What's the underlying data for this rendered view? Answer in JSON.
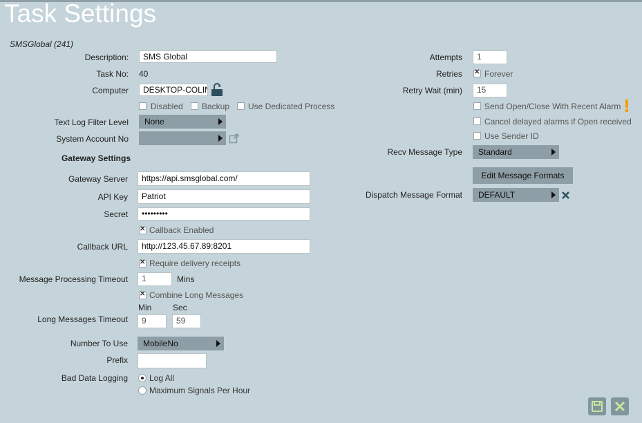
{
  "page": {
    "title": "Task Settings",
    "subtitle": "SMSGlobal (241)"
  },
  "left": {
    "description": {
      "label": "Description:",
      "value": "SMS Global"
    },
    "task_no": {
      "label": "Task No:",
      "value": "40"
    },
    "computer": {
      "label": "Computer",
      "value": "DESKTOP-COLIN"
    },
    "options": {
      "disabled": "Disabled",
      "backup": "Backup",
      "dedicated": "Use Dedicated Process"
    },
    "text_log": {
      "label": "Text Log Filter Level",
      "value": "None"
    },
    "system_account": {
      "label": "System Account No",
      "value": ""
    },
    "gateway_heading": "Gateway Settings",
    "gateway_server": {
      "label": "Gateway Server",
      "value": "https://api.smsglobal.com/"
    },
    "api_key": {
      "label": "API Key",
      "value": "Patriot"
    },
    "secret": {
      "label": "Secret",
      "value": "•••••••••"
    },
    "callback_enabled": "Callback Enabled",
    "callback_url": {
      "label": "Callback URL",
      "value": "http://123.45.67.89:8201"
    },
    "delivery_receipts": "Require delivery receipts",
    "processing_timeout": {
      "label": "Message Processing Timeout",
      "value": "1",
      "unit": "Mins"
    },
    "combine_long": "Combine Long Messages",
    "long_timeout": {
      "label": "Long Messages Timeout",
      "min_label": "Min",
      "sec_label": "Sec",
      "min_value": "9",
      "sec_value": "59"
    },
    "number_to_use": {
      "label": "Number To Use",
      "value": "MobileNo"
    },
    "prefix": {
      "label": "Prefix",
      "value": ""
    },
    "bad_data": {
      "label": "Bad Data Logging",
      "option1": "Log All",
      "option2": "Maximum Signals Per Hour"
    }
  },
  "right": {
    "attempts": {
      "label": "Attempts",
      "value": "1"
    },
    "retries": {
      "label": "Retries",
      "value": "Forever"
    },
    "retry_wait": {
      "label": "Retry Wait (min)",
      "value": "15"
    },
    "send_open_close": "Send Open/Close With Recent Alarm",
    "cancel_delayed": "Cancel delayed alarms if Open received",
    "use_sender_id": "Use Sender ID",
    "recv_type": {
      "label": "Recv Message Type",
      "value": "Standard"
    },
    "edit_formats": "Edit Message Formats",
    "dispatch_format": {
      "label": "Dispatch Message Format",
      "value": "DEFAULT"
    }
  },
  "colors": {
    "background": "#c5d4da",
    "select": "#8e9ea6",
    "warning": "#f5a000",
    "icon": "#2d4f5e"
  }
}
